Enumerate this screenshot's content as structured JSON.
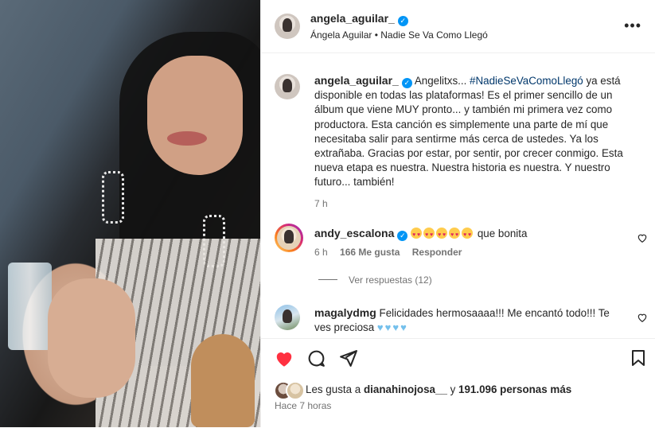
{
  "post": {
    "username": "angela_aguilar_",
    "subtitle": "Ángela Aguilar • Nadie Se Va Como Llegó"
  },
  "caption": {
    "username": "angela_aguilar_",
    "before_hashtag": "Angelitxs... ",
    "hashtag": "#NadieSeVaComoLlegó",
    "after_hashtag": " ya está disponible en todas las plataformas! Es el primer sencillo de un álbum que viene MUY pronto... y también mi primera vez como productora. Esta canción es simplemente una parte de mí que necesitaba salir para sentirme más cerca de ustedes. Ya los extrañaba. Gracias por estar, por sentir, por crecer conmigo. Esta nueva etapa es nuestra. Nuestra historia es nuestra. Y nuestro futuro... también!",
    "time": "7 h"
  },
  "comments": [
    {
      "username": "andy_escalona",
      "text": "que bonita",
      "time": "6 h",
      "likes": "166 Me gusta",
      "reply": "Responder",
      "view_replies": "Ver respuestas (12)"
    },
    {
      "username": "magalydmg",
      "text": "Felicidades hermosaaaa!!! Me encantó todo!!! Te ves preciosa"
    }
  ],
  "footer": {
    "likes_prefix": "Les gusta a ",
    "likes_user": "dianahinojosa__",
    "likes_mid": " y ",
    "likes_count": "191.096 personas más",
    "timestamp": "Hace 7 horas"
  },
  "colors": {
    "accent_blue": "#0095f6",
    "like_red": "#ff3040",
    "hashtag": "#00376b"
  }
}
